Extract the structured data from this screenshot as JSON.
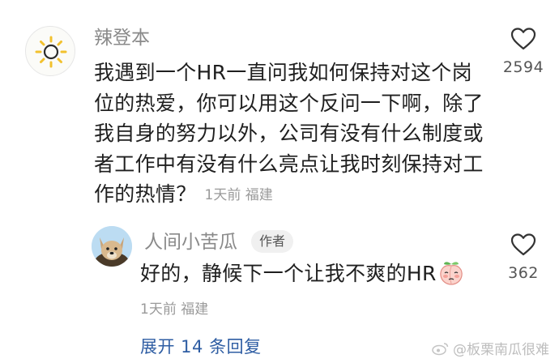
{
  "comment": {
    "username": "辣登本",
    "avatar_icon": "sun-icon",
    "text_lines": [
      "我遇到一个HR一直问我如何保持对这个岗",
      "位的热爱，你可以用这个反问一下啊，除了",
      "我自身的努力以外，公司有没有什么制度或",
      "者工作中有没有什么亮点让我时刻保持对工",
      "作的热情？"
    ],
    "time": "1天前",
    "location": "福建",
    "like_icon": "heart-outline-icon",
    "like_count": "2594"
  },
  "reply": {
    "username": "人间小苦瓜",
    "avatar_icon": "dog-avatar",
    "author_badge": "作者",
    "text": "好的，静候下一个让我不爽的HR",
    "emoji": "peach-emoji",
    "time": "1天前",
    "location": "福建",
    "like_icon": "heart-outline-icon",
    "like_count": "362"
  },
  "expand_replies": "展开 14 条回复",
  "watermark": "@板栗南瓜很难",
  "colors": {
    "text_primary": "#1f1f1f",
    "text_secondary": "#8a8a8a",
    "meta": "#9a9a9a",
    "link": "#2e5da3",
    "sun": "#f2c12e"
  }
}
